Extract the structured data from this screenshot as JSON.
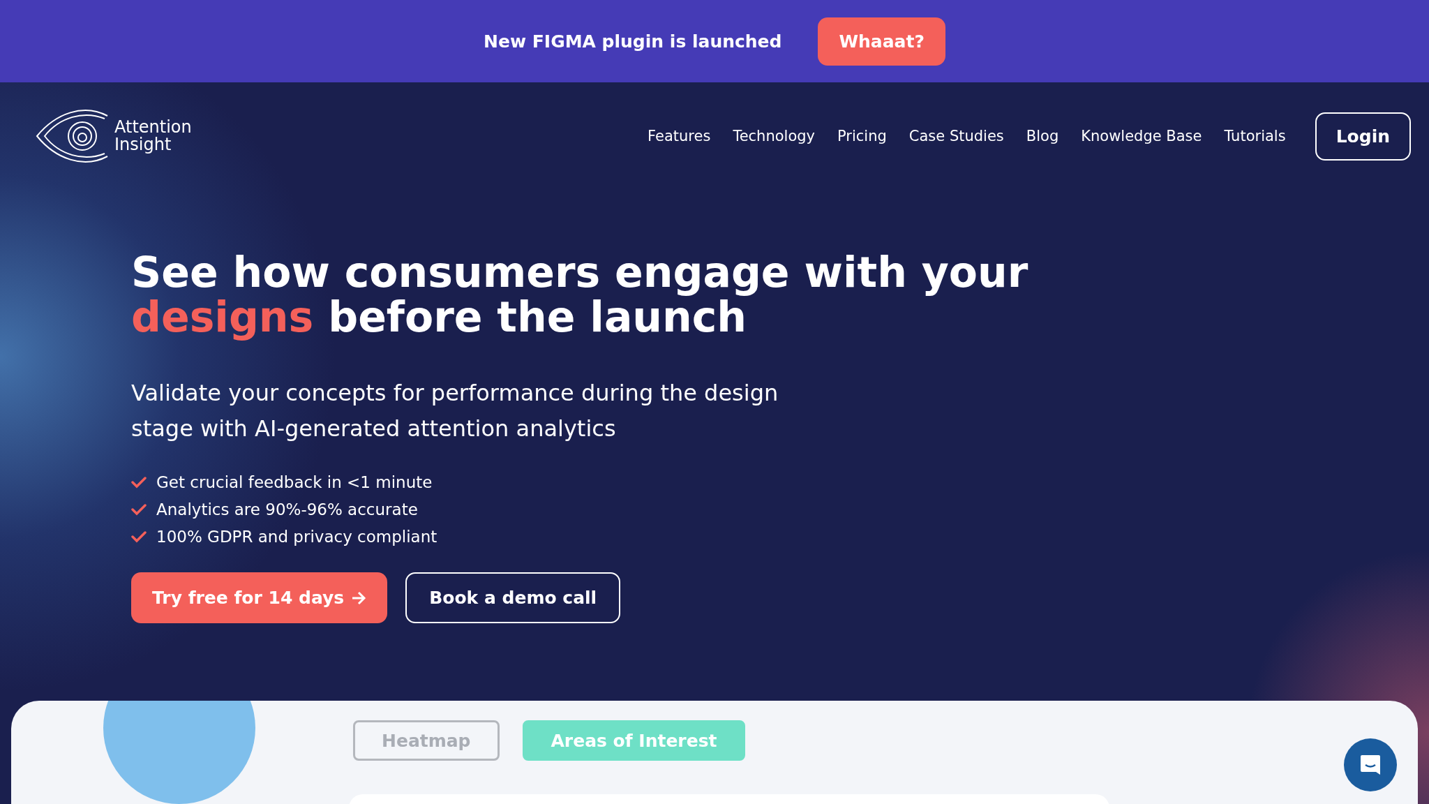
{
  "announcement": {
    "text": "New FIGMA plugin is launched",
    "button": "Whaaat?"
  },
  "logo": {
    "line_1": "Attention",
    "line_2": "Insight"
  },
  "nav": {
    "items": [
      "Features",
      "Technology",
      "Pricing",
      "Case Studies",
      "Blog",
      "Knowledge Base",
      "Tutorials"
    ],
    "login": "Login"
  },
  "hero": {
    "headline": "See how consumers engage with your",
    "highlight": "designs",
    "headline_end": " before the launch",
    "subtitle": "Validate your concepts for performance during the design stage with AI-generated attention analytics",
    "bullets": [
      "Get crucial feedback in <1 minute",
      "Analytics are 90%-96% accurate",
      "100% GDPR and privacy compliant"
    ],
    "primary_button": "Try free for 14 days",
    "secondary_button": "Book a demo call"
  },
  "preview": {
    "tabs": [
      {
        "label": "Heatmap",
        "selected": false
      },
      {
        "label": "Areas of Interest",
        "selected": true
      }
    ]
  }
}
